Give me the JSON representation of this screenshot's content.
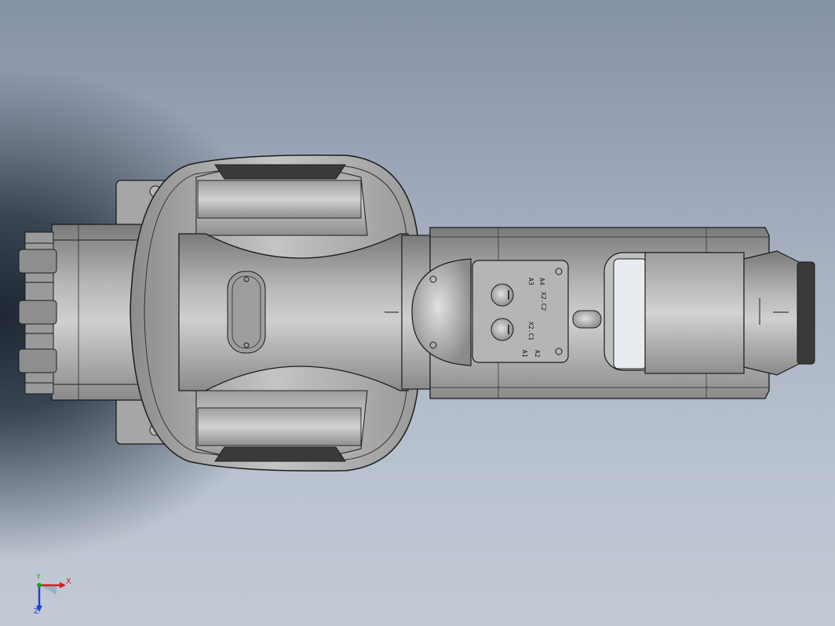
{
  "viewport": {
    "background_top": "#8591a5",
    "background_bottom": "#c3cad6",
    "vignette": "#1e2733"
  },
  "part": {
    "shade_light": "#c9c9c9",
    "shade_mid": "#9e9e9e",
    "shade_dark": "#5a5a5a",
    "edge": "#1c1c1c"
  },
  "connector_labels": {
    "a1": "A1",
    "a2": "A2",
    "a3": "A3",
    "a4": "A4",
    "x2c1": "X2.C1",
    "x2c2": "X2.C2"
  },
  "triad": {
    "x_label": "X",
    "y_label": "Y",
    "z_label": "Z",
    "x_color": "#d02020",
    "y_color": "#20a020",
    "z_color": "#2040d0"
  }
}
